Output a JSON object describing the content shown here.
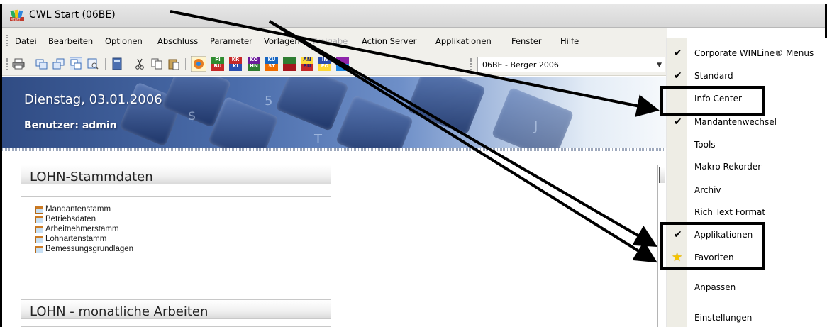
{
  "window": {
    "title": "CWL Start (06BE)",
    "app_icon": "cwl-start-icon"
  },
  "menubar": {
    "items": [
      {
        "label": "Datei",
        "enabled": true
      },
      {
        "label": "Bearbeiten",
        "enabled": true
      },
      {
        "label": "Optionen",
        "enabled": true
      },
      {
        "label": "Abschluss",
        "enabled": true
      },
      {
        "label": "Parameter",
        "enabled": true
      },
      {
        "label": "Vorlagen",
        "enabled": true
      },
      {
        "label": "Freigabe",
        "enabled": false
      },
      {
        "label": "Action Server",
        "enabled": true
      },
      {
        "label": "Applikationen",
        "enabled": true
      },
      {
        "label": "Fenster",
        "enabled": true
      },
      {
        "label": "Hilfe",
        "enabled": true
      }
    ]
  },
  "toolbar": {
    "icons": [
      "print-icon",
      "window-left-icon",
      "window-right-icon",
      "window-tile-icon",
      "window-preview-icon",
      "calculator-icon",
      "cut-icon",
      "copy-icon",
      "paste-icon",
      "cwl-module-icon"
    ],
    "modules": [
      {
        "label": "FI\nBU",
        "icon": "module-fibu-icon"
      },
      {
        "label": "KR\nKI",
        "icon": "module-krki-icon"
      },
      {
        "label": "KO\nHN",
        "icon": "module-lohn-icon"
      },
      {
        "label": "KU\nST",
        "icon": "module-kust-icon"
      },
      {
        "label": "",
        "icon": "module-green-icon"
      },
      {
        "label": "AN\nBU",
        "icon": "module-anbu-icon"
      },
      {
        "label": "IN\nFO",
        "icon": "module-info-icon"
      },
      {
        "label": "",
        "icon": "module-purple-icon"
      }
    ],
    "mandant_select": {
      "value": "06BE - Berger 2006"
    }
  },
  "banner": {
    "date": "Dienstag, 03.01.2006",
    "user": "Benutzer: admin"
  },
  "panels": [
    {
      "title": "LOHN-Stammdaten",
      "items": [
        "Mandantenstamm",
        "Betriebsdaten",
        "Arbeitnehmerstamm",
        "Lohnartenstamm",
        "Bemessungsgrundlagen"
      ]
    },
    {
      "title": "LOHN - monatliche Arbeiten",
      "items": []
    }
  ],
  "context_menu": {
    "items": [
      {
        "label": "Corporate WINLine® Menus",
        "checked": true
      },
      {
        "label": "Standard",
        "checked": true
      },
      {
        "label": "Info Center",
        "checked": false
      },
      {
        "label": "Mandantenwechsel",
        "checked": true
      },
      {
        "label": "Tools",
        "checked": false
      },
      {
        "label": "Makro Rekorder",
        "checked": false
      },
      {
        "label": "Archiv",
        "checked": false
      },
      {
        "label": "Rich Text Format",
        "checked": false
      },
      {
        "label": "Applikationen",
        "checked": true
      },
      {
        "label": "Favoriten",
        "checked": false,
        "icon": "star-icon"
      },
      {
        "label": "Anpassen",
        "checked": false
      },
      {
        "label": "Einstellungen",
        "checked": false
      }
    ]
  },
  "colors": {
    "banner_dark": "#304c84",
    "menu_bg": "#f1f0eb",
    "annotation": "#000000"
  }
}
